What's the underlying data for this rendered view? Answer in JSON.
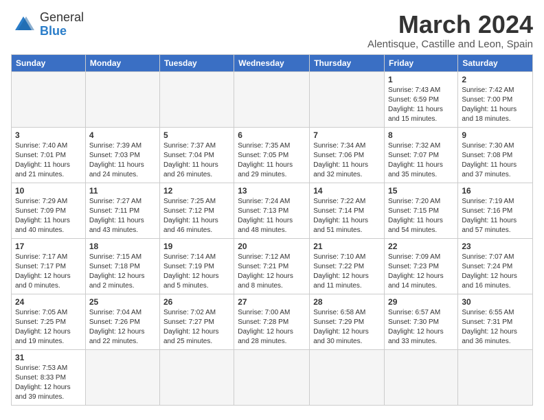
{
  "header": {
    "logo_general": "General",
    "logo_blue": "Blue",
    "month_title": "March 2024",
    "location": "Alentisque, Castille and Leon, Spain"
  },
  "weekdays": [
    "Sunday",
    "Monday",
    "Tuesday",
    "Wednesday",
    "Thursday",
    "Friday",
    "Saturday"
  ],
  "weeks": [
    [
      {
        "day": "",
        "info": ""
      },
      {
        "day": "",
        "info": ""
      },
      {
        "day": "",
        "info": ""
      },
      {
        "day": "",
        "info": ""
      },
      {
        "day": "",
        "info": ""
      },
      {
        "day": "1",
        "info": "Sunrise: 7:43 AM\nSunset: 6:59 PM\nDaylight: 11 hours and 15 minutes."
      },
      {
        "day": "2",
        "info": "Sunrise: 7:42 AM\nSunset: 7:00 PM\nDaylight: 11 hours and 18 minutes."
      }
    ],
    [
      {
        "day": "3",
        "info": "Sunrise: 7:40 AM\nSunset: 7:01 PM\nDaylight: 11 hours and 21 minutes."
      },
      {
        "day": "4",
        "info": "Sunrise: 7:39 AM\nSunset: 7:03 PM\nDaylight: 11 hours and 24 minutes."
      },
      {
        "day": "5",
        "info": "Sunrise: 7:37 AM\nSunset: 7:04 PM\nDaylight: 11 hours and 26 minutes."
      },
      {
        "day": "6",
        "info": "Sunrise: 7:35 AM\nSunset: 7:05 PM\nDaylight: 11 hours and 29 minutes."
      },
      {
        "day": "7",
        "info": "Sunrise: 7:34 AM\nSunset: 7:06 PM\nDaylight: 11 hours and 32 minutes."
      },
      {
        "day": "8",
        "info": "Sunrise: 7:32 AM\nSunset: 7:07 PM\nDaylight: 11 hours and 35 minutes."
      },
      {
        "day": "9",
        "info": "Sunrise: 7:30 AM\nSunset: 7:08 PM\nDaylight: 11 hours and 37 minutes."
      }
    ],
    [
      {
        "day": "10",
        "info": "Sunrise: 7:29 AM\nSunset: 7:09 PM\nDaylight: 11 hours and 40 minutes."
      },
      {
        "day": "11",
        "info": "Sunrise: 7:27 AM\nSunset: 7:11 PM\nDaylight: 11 hours and 43 minutes."
      },
      {
        "day": "12",
        "info": "Sunrise: 7:25 AM\nSunset: 7:12 PM\nDaylight: 11 hours and 46 minutes."
      },
      {
        "day": "13",
        "info": "Sunrise: 7:24 AM\nSunset: 7:13 PM\nDaylight: 11 hours and 48 minutes."
      },
      {
        "day": "14",
        "info": "Sunrise: 7:22 AM\nSunset: 7:14 PM\nDaylight: 11 hours and 51 minutes."
      },
      {
        "day": "15",
        "info": "Sunrise: 7:20 AM\nSunset: 7:15 PM\nDaylight: 11 hours and 54 minutes."
      },
      {
        "day": "16",
        "info": "Sunrise: 7:19 AM\nSunset: 7:16 PM\nDaylight: 11 hours and 57 minutes."
      }
    ],
    [
      {
        "day": "17",
        "info": "Sunrise: 7:17 AM\nSunset: 7:17 PM\nDaylight: 12 hours and 0 minutes."
      },
      {
        "day": "18",
        "info": "Sunrise: 7:15 AM\nSunset: 7:18 PM\nDaylight: 12 hours and 2 minutes."
      },
      {
        "day": "19",
        "info": "Sunrise: 7:14 AM\nSunset: 7:19 PM\nDaylight: 12 hours and 5 minutes."
      },
      {
        "day": "20",
        "info": "Sunrise: 7:12 AM\nSunset: 7:21 PM\nDaylight: 12 hours and 8 minutes."
      },
      {
        "day": "21",
        "info": "Sunrise: 7:10 AM\nSunset: 7:22 PM\nDaylight: 12 hours and 11 minutes."
      },
      {
        "day": "22",
        "info": "Sunrise: 7:09 AM\nSunset: 7:23 PM\nDaylight: 12 hours and 14 minutes."
      },
      {
        "day": "23",
        "info": "Sunrise: 7:07 AM\nSunset: 7:24 PM\nDaylight: 12 hours and 16 minutes."
      }
    ],
    [
      {
        "day": "24",
        "info": "Sunrise: 7:05 AM\nSunset: 7:25 PM\nDaylight: 12 hours and 19 minutes."
      },
      {
        "day": "25",
        "info": "Sunrise: 7:04 AM\nSunset: 7:26 PM\nDaylight: 12 hours and 22 minutes."
      },
      {
        "day": "26",
        "info": "Sunrise: 7:02 AM\nSunset: 7:27 PM\nDaylight: 12 hours and 25 minutes."
      },
      {
        "day": "27",
        "info": "Sunrise: 7:00 AM\nSunset: 7:28 PM\nDaylight: 12 hours and 28 minutes."
      },
      {
        "day": "28",
        "info": "Sunrise: 6:58 AM\nSunset: 7:29 PM\nDaylight: 12 hours and 30 minutes."
      },
      {
        "day": "29",
        "info": "Sunrise: 6:57 AM\nSunset: 7:30 PM\nDaylight: 12 hours and 33 minutes."
      },
      {
        "day": "30",
        "info": "Sunrise: 6:55 AM\nSunset: 7:31 PM\nDaylight: 12 hours and 36 minutes."
      }
    ],
    [
      {
        "day": "31",
        "info": "Sunrise: 7:53 AM\nSunset: 8:33 PM\nDaylight: 12 hours and 39 minutes."
      },
      {
        "day": "",
        "info": ""
      },
      {
        "day": "",
        "info": ""
      },
      {
        "day": "",
        "info": ""
      },
      {
        "day": "",
        "info": ""
      },
      {
        "day": "",
        "info": ""
      },
      {
        "day": "",
        "info": ""
      }
    ]
  ]
}
